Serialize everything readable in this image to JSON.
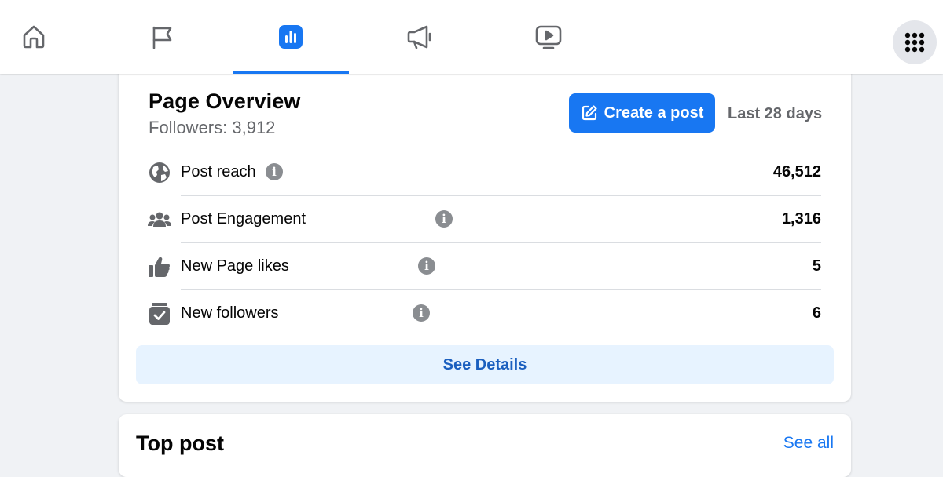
{
  "nav": {
    "tabs": [
      {
        "name": "home",
        "icon": "home-icon",
        "active": false
      },
      {
        "name": "pages",
        "icon": "flag-icon",
        "active": false
      },
      {
        "name": "insights",
        "icon": "bar-chart-icon",
        "active": true
      },
      {
        "name": "ads",
        "icon": "megaphone-icon",
        "active": false
      },
      {
        "name": "video",
        "icon": "video-icon",
        "active": false
      }
    ],
    "menu_icon": "grid-menu-icon",
    "accent_color": "#1877f2"
  },
  "overview": {
    "title": "Page Overview",
    "followers": "Followers: 3,912",
    "create_post_label": "Create a post",
    "range": "Last 28 days",
    "metrics": [
      {
        "label": "Post reach",
        "value": "46,512",
        "icon": "globe-icon"
      },
      {
        "label": "Post Engagement",
        "value": "1,316",
        "icon": "people-icon"
      },
      {
        "label": "New Page likes",
        "value": "5",
        "icon": "thumbs-up-icon"
      },
      {
        "label": "New followers",
        "value": "6",
        "icon": "follower-check-icon"
      }
    ],
    "see_details_label": "See Details"
  },
  "top_post": {
    "title": "Top post",
    "see_all_label": "See all"
  }
}
